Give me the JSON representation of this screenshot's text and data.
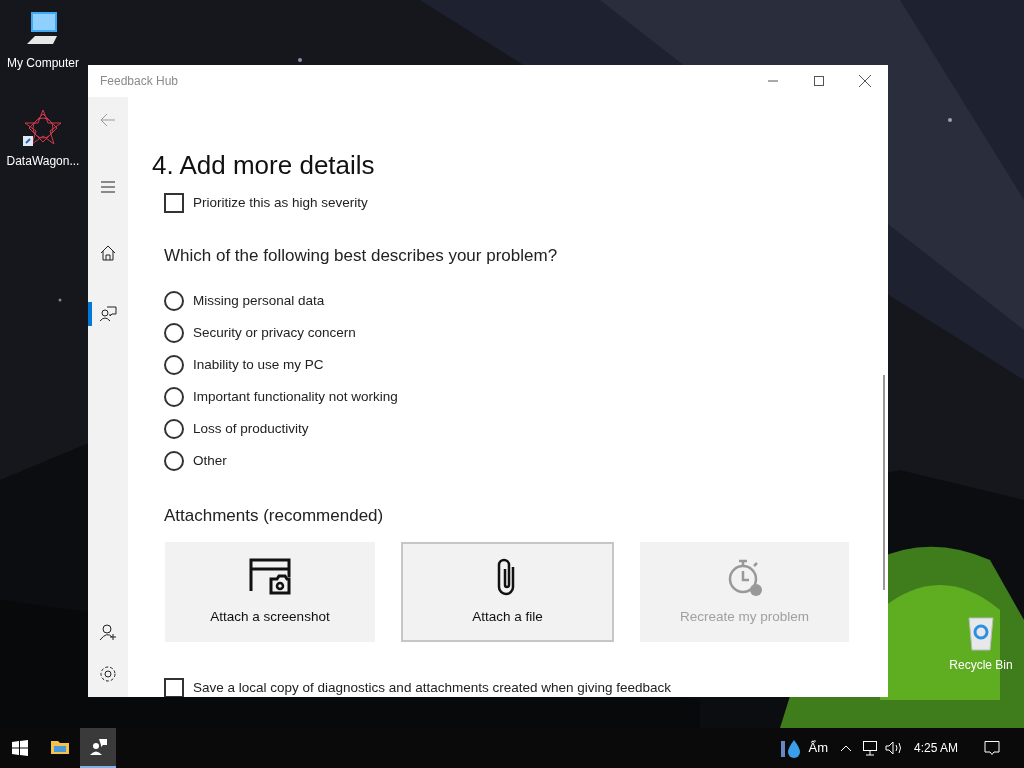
{
  "desktop_icons": [
    {
      "kind": "computer",
      "label": "My Computer"
    },
    {
      "kind": "app",
      "label": "DataWagon..."
    },
    {
      "kind": "recycle",
      "label": "Recycle Bin"
    }
  ],
  "window": {
    "title": "Feedback Hub"
  },
  "nav": [
    {
      "kind": "back",
      "selected": false
    },
    {
      "kind": "menu",
      "selected": false
    },
    {
      "kind": "home",
      "selected": false
    },
    {
      "kind": "feedback",
      "selected": true
    }
  ],
  "nav_bottom": [
    {
      "kind": "account"
    },
    {
      "kind": "settings"
    }
  ],
  "heading": "4. Add more details",
  "severity": {
    "label": "Prioritize this as high severity",
    "checked": false
  },
  "question": "Which of the following best describes your problem?",
  "options": [
    {
      "label": "Missing personal data",
      "selected": false
    },
    {
      "label": "Security or privacy concern",
      "selected": false
    },
    {
      "label": "Inability to use my PC",
      "selected": false
    },
    {
      "label": "Important functionality not working",
      "selected": false
    },
    {
      "label": "Loss of productivity",
      "selected": false
    },
    {
      "label": "Other",
      "selected": false
    }
  ],
  "attachments_heading": "Attachments (recommended)",
  "attachments": [
    {
      "kind": "screenshot",
      "label": "Attach a screenshot",
      "focused": false,
      "disabled": false
    },
    {
      "kind": "file",
      "label": "Attach a file",
      "focused": true,
      "disabled": false
    },
    {
      "kind": "recreate",
      "label": "Recreate my problem",
      "focused": false,
      "disabled": true
    }
  ],
  "save_copy": {
    "label": "Save a local copy of diagnostics and attachments created when giving feedback",
    "checked": false
  },
  "taskbar": {
    "apps": [
      {
        "kind": "folder",
        "active": false
      },
      {
        "kind": "feedback",
        "active": true
      }
    ],
    "weather": "Ẩm",
    "clock": "4:25 AM"
  }
}
